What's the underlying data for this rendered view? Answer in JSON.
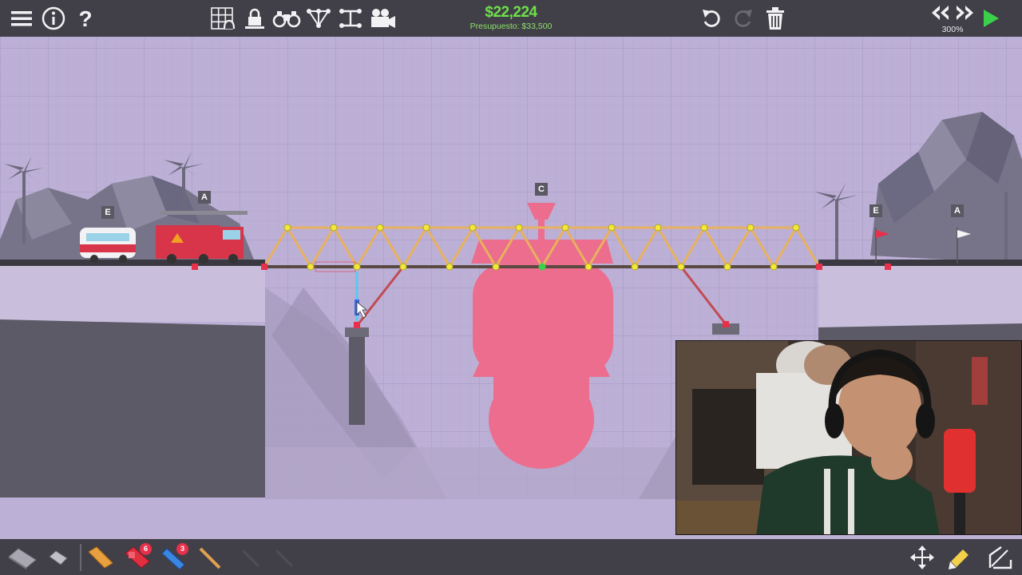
{
  "toolbar": {
    "menu_icon": "hamburger-menu-icon",
    "info_icon": "info-icon",
    "help_icon": "help-question-icon",
    "grid_icon": "grid-snap-icon",
    "anchor_lock_icon": "lock-icon",
    "view_icon": "binoculars-icon",
    "stress_icon": "stress-view-icon",
    "layout_icon": "layout-tool-icon",
    "camera_icon": "camera-icon",
    "undo_icon": "undo-icon",
    "redo_icon": "redo-icon",
    "delete_icon": "trash-icon",
    "rewind_icon": "rewind-icon",
    "fast_forward_icon": "fast-forward-icon",
    "play_icon": "play-icon"
  },
  "budget": {
    "amount": "$22,224",
    "label": "Presupuesto: $33,500"
  },
  "speed": "300%",
  "scene": {
    "checkpoint_labels": {
      "left_e": "E",
      "left_a": "A",
      "center_c": "C",
      "right_e": "E",
      "right_a": "A"
    },
    "colors": {
      "background": "#bdb0d6",
      "ship": "#ef6a8a",
      "joint": "#f2e83a",
      "anchor": "#e8304a",
      "wood": "#e7b160",
      "road": "#5a4a42"
    }
  },
  "materials": {
    "items": [
      {
        "name": "road",
        "badge": ""
      },
      {
        "name": "reinforced-road",
        "badge": ""
      },
      {
        "name": "wood",
        "badge": ""
      },
      {
        "name": "hydraulics",
        "badge": "6"
      },
      {
        "name": "rope",
        "badge": "3"
      },
      {
        "name": "steel",
        "badge": ""
      }
    ]
  },
  "bottom_right": {
    "move_icon": "move-arrows-icon",
    "edit_icon": "pencil-eraser-icon",
    "split_icon": "split-joint-icon"
  }
}
